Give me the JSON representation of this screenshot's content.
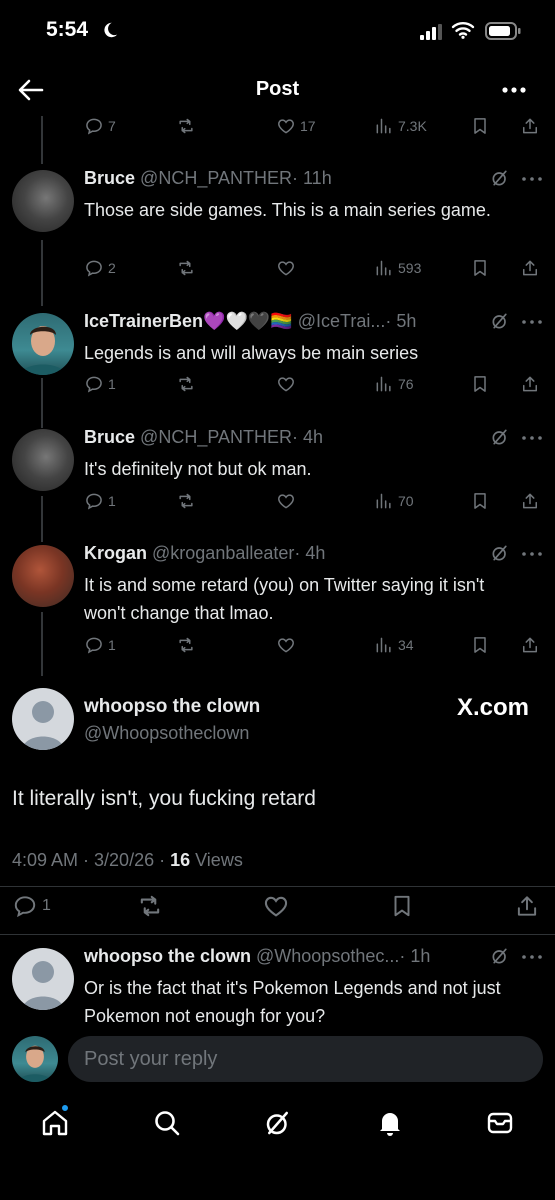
{
  "status_bar": {
    "time": "5:54"
  },
  "header": {
    "title": "Post"
  },
  "top_actions": {
    "reply_count": "7",
    "like_count": "17",
    "view_count": "7.3K"
  },
  "replies": [
    {
      "name": "Bruce",
      "handle": "@NCH_PANTHER",
      "time": "· 11h",
      "text": "Those are side games. This is a main series game.",
      "reply_count": "2",
      "view_count": "593"
    },
    {
      "name": "IceTrainerBen💜🤍🖤🏳️‍🌈",
      "handle": "@IceTrai...",
      "time": "· 5h",
      "text": "Legends is and will always be main series",
      "reply_count": "1",
      "view_count": "76"
    },
    {
      "name": "Bruce",
      "handle": "@NCH_PANTHER",
      "time": "· 4h",
      "text": "It's definitely not but ok man.",
      "reply_count": "1",
      "view_count": "70"
    },
    {
      "name": "Krogan",
      "handle": "@kroganballeater",
      "time": "· 4h",
      "text": "It is and some retard (you) on Twitter saying it isn't won't change that lmao.",
      "reply_count": "1",
      "view_count": "34"
    }
  ],
  "main_post": {
    "name": "whoopso the clown",
    "handle": "@Whoopsotheclown",
    "watermark": "X.com",
    "text": "It literally isn't, you fucking retard",
    "timestamp": "4:09 AM · 3/20/26 · ",
    "views_count": "16",
    "views_label": " Views",
    "reply_count": "1"
  },
  "bottom_reply": {
    "name": "whoopso the clown",
    "handle": "@Whoopsothec...",
    "time": "· 1h",
    "text": "Or is the fact that it's Pokemon Legends and not just Pokemon not enough for you?"
  },
  "composer": {
    "placeholder": "Post your reply"
  },
  "colors": {
    "background": "#000000",
    "text": "#e7e9ea",
    "muted": "#71767b",
    "accent": "#1d9bf0",
    "input": "#202327"
  },
  "icons": [
    "back-arrow-icon",
    "more-icon",
    "reply-icon",
    "repost-icon",
    "like-icon",
    "views-icon",
    "bookmark-icon",
    "share-icon",
    "grok-icon",
    "home-icon",
    "search-icon",
    "grok-tab-icon",
    "notifications-icon",
    "messages-icon"
  ]
}
